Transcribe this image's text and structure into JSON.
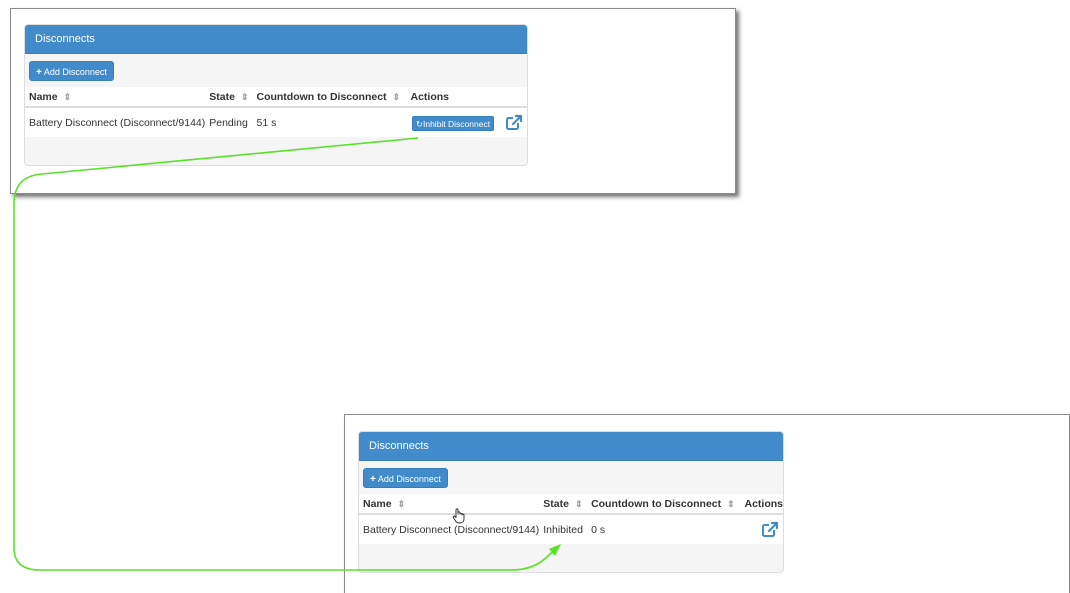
{
  "panel": {
    "title": "Disconnects",
    "add_button_label": "Add Disconnect"
  },
  "table": {
    "headers": {
      "name": "Name",
      "state": "State",
      "countdown": "Countdown to Disconnect",
      "actions": "Actions"
    }
  },
  "before": {
    "row": {
      "name": "Battery Disconnect (Disconnect/9144)",
      "state": "Pending",
      "countdown": "51 s",
      "action_label": "Inhibit Disconnect"
    }
  },
  "after": {
    "row": {
      "name": "Battery Disconnect (Disconnect/9144)",
      "state": "Inhibited",
      "countdown": "0 s"
    }
  },
  "colors": {
    "accent": "#428bca",
    "arrow": "#5ce02a"
  },
  "icons": [
    "plus-icon",
    "sort-icon",
    "refresh-icon",
    "external-link-icon",
    "hand-cursor-icon"
  ]
}
